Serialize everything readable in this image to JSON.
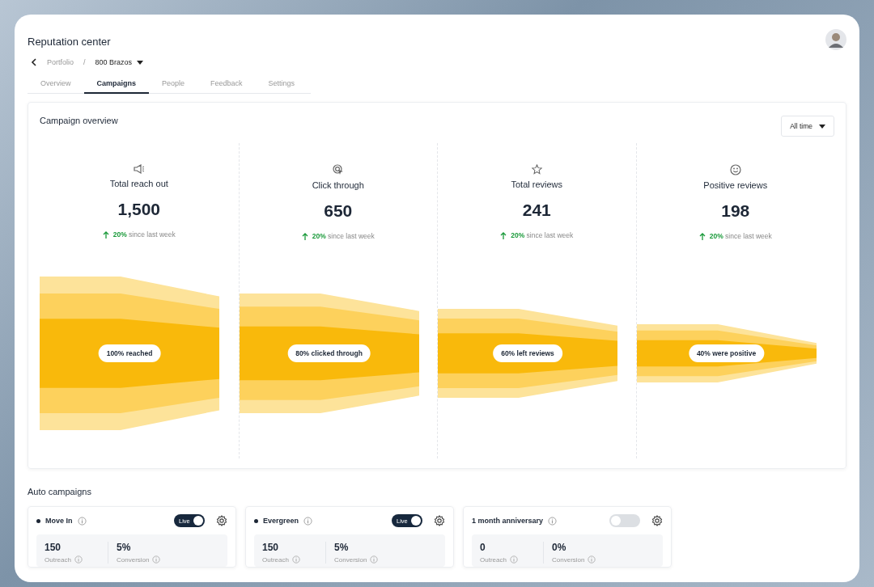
{
  "page": {
    "title": "Reputation center"
  },
  "breadcrumb": {
    "parent": "Portfolio",
    "separator": "/",
    "current": "800 Brazos"
  },
  "tabs": [
    {
      "label": "Overview",
      "selected": false
    },
    {
      "label": "Campaigns",
      "selected": true
    },
    {
      "label": "People",
      "selected": false
    },
    {
      "label": "Feedback",
      "selected": false
    },
    {
      "label": "Settings",
      "selected": false
    }
  ],
  "overview": {
    "title": "Campaign overview",
    "period": "All time",
    "stages": [
      {
        "kind": "reach",
        "label": "Total reach out",
        "value": "1,500",
        "change": "20%",
        "change_text": "since last week",
        "funnel_label": "100% reached"
      },
      {
        "kind": "clicks",
        "label": "Click through",
        "value": "650",
        "change": "20%",
        "change_text": "since last week",
        "funnel_label": "80% clicked through"
      },
      {
        "kind": "reviews",
        "label": "Total reviews",
        "value": "241",
        "change": "20%",
        "change_text": "since last week",
        "funnel_label": "60% left reviews"
      },
      {
        "kind": "positive",
        "label": "Positive reviews",
        "value": "198",
        "change": "20%",
        "change_text": "since last week",
        "funnel_label": "40% were positive"
      }
    ]
  },
  "auto_campaigns": {
    "title": "Auto campaigns",
    "cards": [
      {
        "name": "Move In",
        "on": true,
        "toggle_label": "Live",
        "outreach": "150",
        "outreach_label": "Outreach",
        "conversion": "5%",
        "conversion_label": "Conversion"
      },
      {
        "name": "Evergreen",
        "on": true,
        "toggle_label": "Live",
        "outreach": "150",
        "outreach_label": "Outreach",
        "conversion": "5%",
        "conversion_label": "Conversion"
      },
      {
        "name": "1 month anniversary",
        "on": false,
        "outreach": "0",
        "outreach_label": "Outreach",
        "conversion": "0%",
        "conversion_label": "Conversion"
      }
    ]
  }
}
